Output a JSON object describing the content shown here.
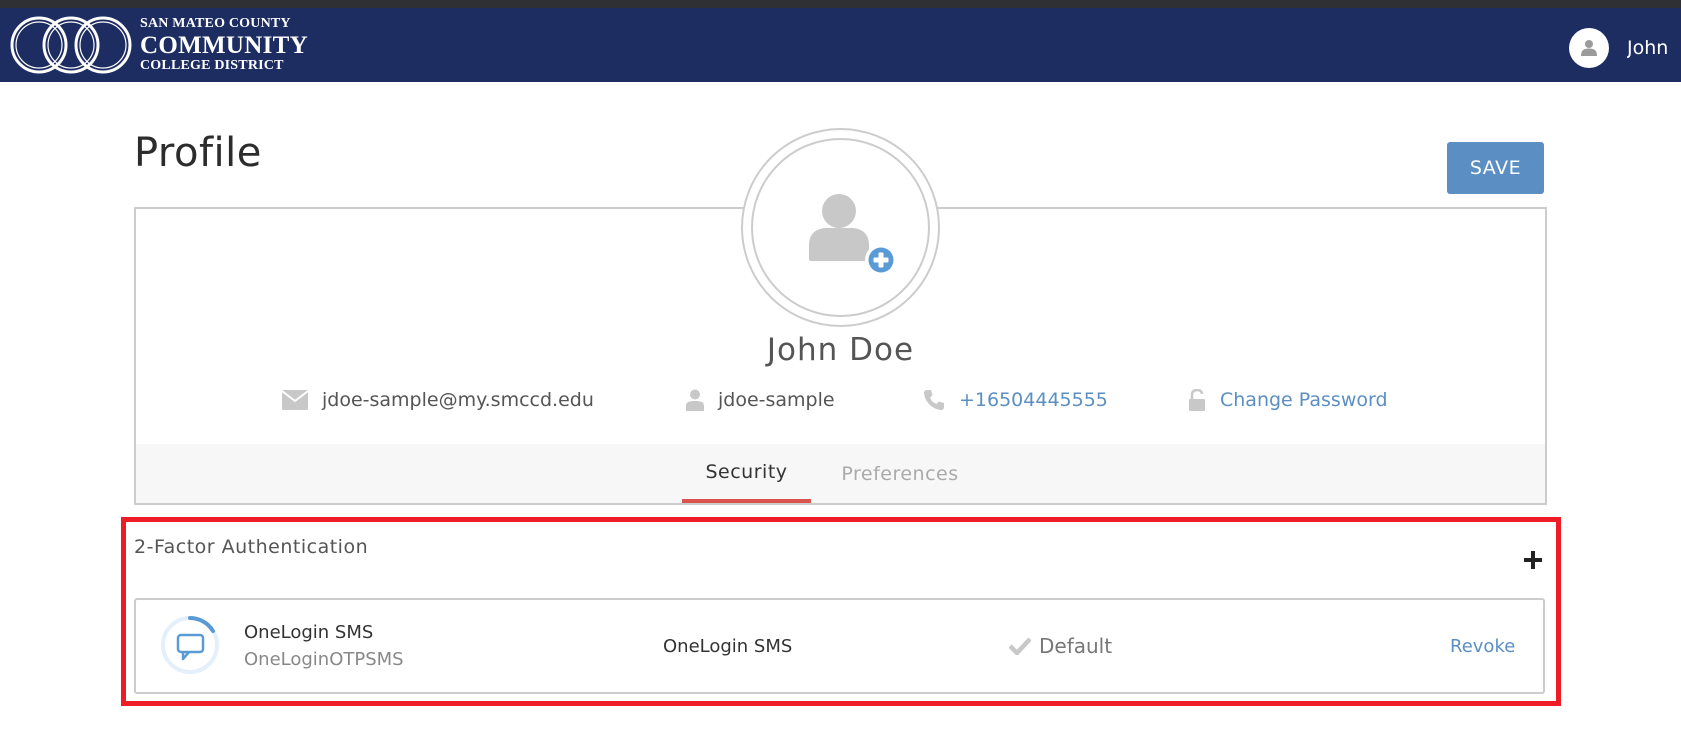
{
  "header": {
    "logo": {
      "line1": "SAN MATEO COUNTY",
      "line2": "COMMUNITY",
      "line3": "COLLEGE DISTRICT"
    },
    "user_name": "John",
    "user_icon": "user-avatar-icon"
  },
  "page": {
    "title": "Profile",
    "save_label": "SAVE"
  },
  "profile": {
    "full_name": "John Doe",
    "avatar_icon": "user-add-icon",
    "email": "jdoe-sample@my.smccd.edu",
    "username": "jdoe-sample",
    "phone": "+16504445555",
    "change_password_label": "Change Password",
    "icons": {
      "email": "envelope-icon",
      "username": "user-icon",
      "phone": "phone-icon",
      "password": "unlock-icon"
    }
  },
  "tabs": [
    {
      "label": "Security",
      "active": true
    },
    {
      "label": "Preferences",
      "active": false
    }
  ],
  "two_factor": {
    "title": "2-Factor Authentication",
    "add_icon": "plus-icon",
    "factors": [
      {
        "icon": "chat-bubble-icon",
        "name": "OneLogin SMS",
        "sub": "OneLoginOTPSMS",
        "type": "OneLogin SMS",
        "default_label": "Default",
        "revoke_label": "Revoke"
      }
    ]
  },
  "colors": {
    "header_bg": "#1d2d61",
    "accent_blue": "#5b8fc3",
    "active_tab_underline": "#d9534f",
    "highlight_border": "#ee1c25"
  }
}
